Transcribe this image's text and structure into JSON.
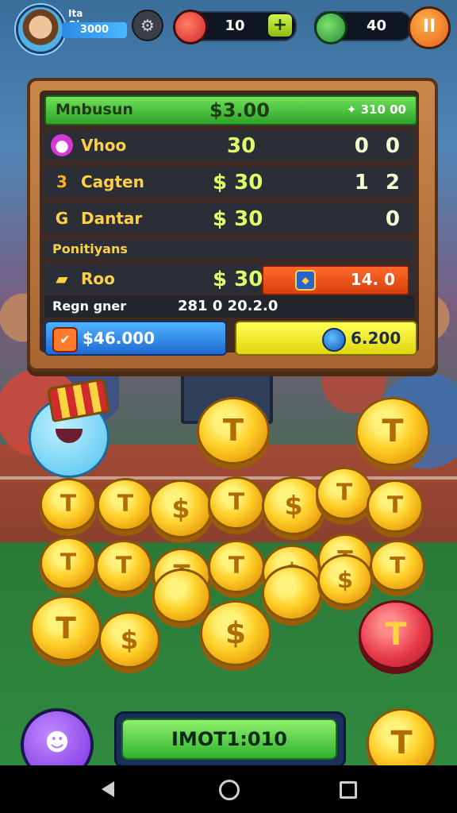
{
  "hud": {
    "player_name": "Ita Olomnan",
    "player_score": "3000",
    "gems": "10",
    "energy": "40",
    "plus_label": "+",
    "pause_label": "II"
  },
  "panel": {
    "header": {
      "label": "Mnbusun",
      "amount": "$3.00",
      "right": "✦ 310 00"
    },
    "rows": [
      {
        "icon": "●",
        "label": "Vhoo",
        "amount": "30",
        "right": "0 0"
      },
      {
        "icon": "3",
        "label": "Cagten",
        "amount": "$ 30",
        "right": "1 2"
      },
      {
        "icon": "G",
        "label": "Dantar",
        "amount": "$ 30",
        "right": "0"
      }
    ],
    "sub_label": "Ponitiyans",
    "bonus_row": {
      "label": "Roo",
      "amount": "$ 30",
      "bonus_value": "14. 0"
    },
    "stat_row": {
      "label": "Regn gner",
      "value": "281 0 20.2.0"
    },
    "blue_button": {
      "value": "$46.000"
    },
    "yellow_button": {
      "value": "6.200"
    }
  },
  "bottom": {
    "main_button_label": "IMOT1:010",
    "ghost_icon": "ghost-icon"
  },
  "colors": {
    "accent_green": "#2fa22a",
    "accent_orange": "#e5611a",
    "coin_gold": "#ffd02a",
    "panel_wood": "#a86532"
  }
}
